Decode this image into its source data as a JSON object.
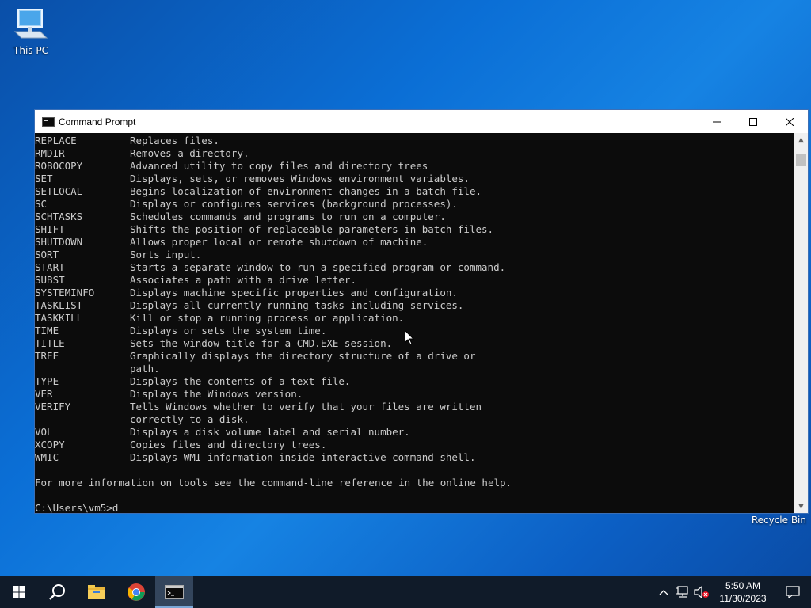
{
  "desktop": {
    "this_pc_label": "This PC",
    "recycle_bin_label": "Recycle Bin"
  },
  "window": {
    "title": "Command Prompt",
    "minimize_icon": "minimize-icon",
    "maximize_icon": "maximize-icon",
    "close_icon": "close-icon"
  },
  "console": {
    "lines": [
      {
        "cmd": "REPLACE",
        "desc": "Replaces files."
      },
      {
        "cmd": "RMDIR",
        "desc": "Removes a directory."
      },
      {
        "cmd": "ROBOCOPY",
        "desc": "Advanced utility to copy files and directory trees"
      },
      {
        "cmd": "SET",
        "desc": "Displays, sets, or removes Windows environment variables."
      },
      {
        "cmd": "SETLOCAL",
        "desc": "Begins localization of environment changes in a batch file."
      },
      {
        "cmd": "SC",
        "desc": "Displays or configures services (background processes)."
      },
      {
        "cmd": "SCHTASKS",
        "desc": "Schedules commands and programs to run on a computer."
      },
      {
        "cmd": "SHIFT",
        "desc": "Shifts the position of replaceable parameters in batch files."
      },
      {
        "cmd": "SHUTDOWN",
        "desc": "Allows proper local or remote shutdown of machine."
      },
      {
        "cmd": "SORT",
        "desc": "Sorts input."
      },
      {
        "cmd": "START",
        "desc": "Starts a separate window to run a specified program or command."
      },
      {
        "cmd": "SUBST",
        "desc": "Associates a path with a drive letter."
      },
      {
        "cmd": "SYSTEMINFO",
        "desc": "Displays machine specific properties and configuration."
      },
      {
        "cmd": "TASKLIST",
        "desc": "Displays all currently running tasks including services."
      },
      {
        "cmd": "TASKKILL",
        "desc": "Kill or stop a running process or application."
      },
      {
        "cmd": "TIME",
        "desc": "Displays or sets the system time."
      },
      {
        "cmd": "TITLE",
        "desc": "Sets the window title for a CMD.EXE session."
      },
      {
        "cmd": "TREE",
        "desc": "Graphically displays the directory structure of a drive or"
      },
      {
        "cmd": "",
        "desc": "path."
      },
      {
        "cmd": "TYPE",
        "desc": "Displays the contents of a text file."
      },
      {
        "cmd": "VER",
        "desc": "Displays the Windows version."
      },
      {
        "cmd": "VERIFY",
        "desc": "Tells Windows whether to verify that your files are written"
      },
      {
        "cmd": "",
        "desc": "correctly to a disk."
      },
      {
        "cmd": "VOL",
        "desc": "Displays a disk volume label and serial number."
      },
      {
        "cmd": "XCOPY",
        "desc": "Copies files and directory trees."
      },
      {
        "cmd": "WMIC",
        "desc": "Displays WMI information inside interactive command shell."
      },
      {
        "cmd": "",
        "desc": ""
      },
      {
        "cmd": "",
        "desc": "For more information on tools see the command-line reference in the online help."
      },
      {
        "cmd": "",
        "desc": ""
      },
      {
        "cmd": "",
        "desc": "C:\\Users\\vm5>d"
      }
    ]
  },
  "taskbar": {
    "items": [
      "start-icon",
      "search-icon",
      "file-explorer-icon",
      "chrome-icon",
      "command-prompt-icon"
    ],
    "time": "5:50 AM",
    "date": "11/30/2023"
  },
  "colors": {
    "console_bg": "#0c0c0c",
    "console_fg": "#cccccc",
    "taskbar_bg": "#101b29",
    "desktop_accent": "#0b6fd6"
  }
}
